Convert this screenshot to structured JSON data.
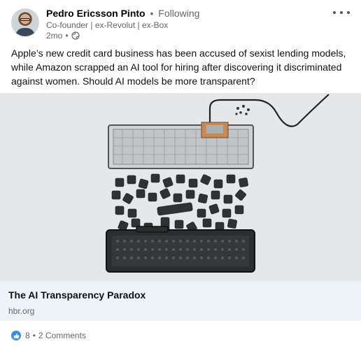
{
  "author": {
    "name": "Pedro Ericsson Pinto",
    "follow_status": "Following",
    "headline": "Co-founder | ex-Revolut | ex-Box",
    "time": "2mo",
    "separator": "•"
  },
  "post": {
    "text": "Apple’s new credit card business has been accused of sexist lending models, while Amazon scrapped an AI tool for hiring after discovering it discriminated against women. Should AI models be more transparent?"
  },
  "link_preview": {
    "title": "The AI Transparency Paradox",
    "domain": "hbr.org"
  },
  "social": {
    "reactions": "8",
    "separator": "•",
    "comments": "2 Comments"
  },
  "icons": {
    "menu": "more-horizontal-icon",
    "visibility": "globe-icon",
    "reaction": "like-icon"
  },
  "colors": {
    "like": "#378fe9",
    "link_card_bg": "#eef3f8",
    "secondary_text": "#666666"
  }
}
